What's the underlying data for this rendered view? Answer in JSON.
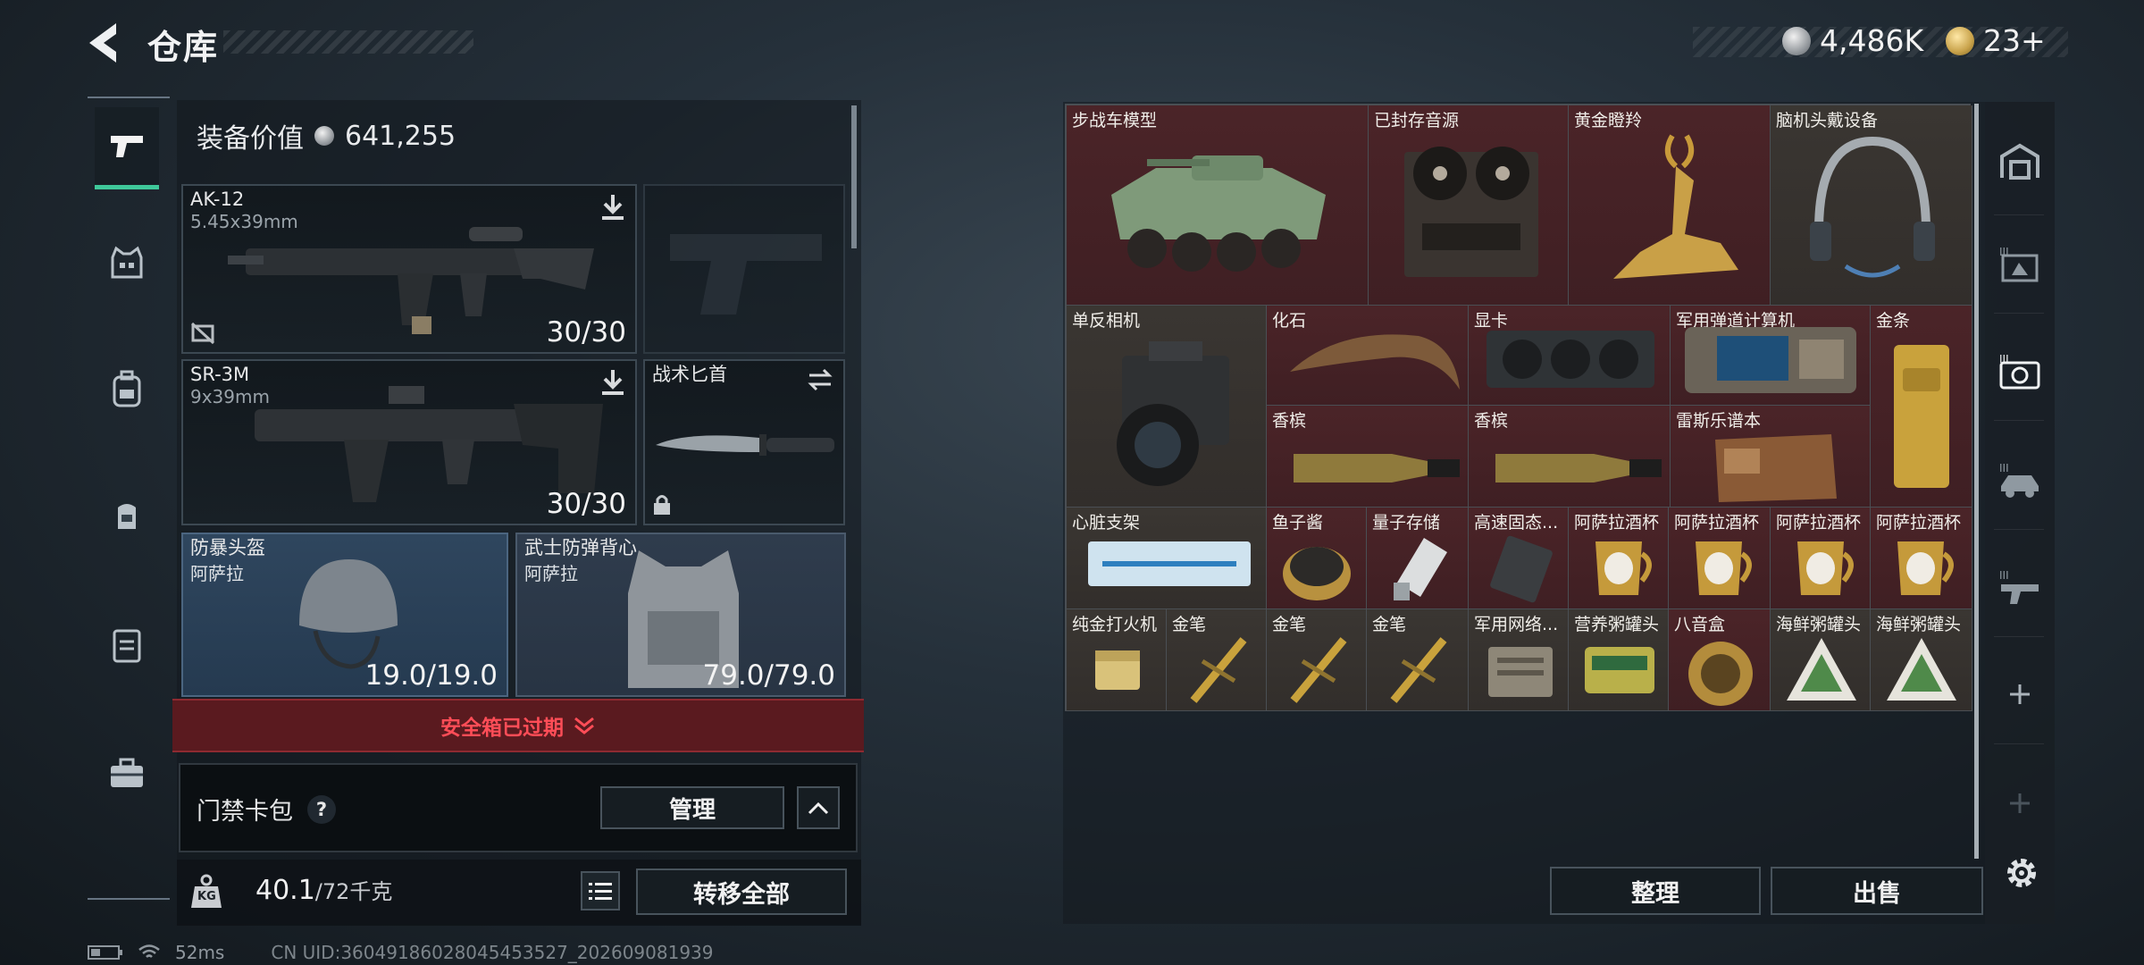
{
  "header": {
    "title": "仓库"
  },
  "currencies": {
    "silver": "4,486K",
    "gold": "23+"
  },
  "equipment": {
    "value_label": "装备价值",
    "value": "641,255",
    "slots": {
      "primary": {
        "name": "AK-12",
        "caliber": "5.45x39mm",
        "ammo": "30/30"
      },
      "secondary": {
        "name": "SR-3M",
        "caliber": "9x39mm",
        "ammo": "30/30"
      },
      "melee": {
        "name": "战术匕首"
      },
      "helmet": {
        "name": "防暴头盔",
        "brand": "阿萨拉",
        "durability": "19.0/19.0"
      },
      "vest": {
        "name": "武士防弹背心",
        "brand": "阿萨拉",
        "durability": "79.0/79.0"
      }
    },
    "safe_box_label": "安全箱已过期",
    "card_pack_label": "门禁卡包",
    "question_mark": "?",
    "manage_label": "管理",
    "weight_value": "40.1",
    "weight_limit": "/72千克",
    "weight_icon_text": "KG",
    "transfer_all_label": "转移全部"
  },
  "status": {
    "ping": "52ms",
    "uid": "CN UID:3604918602804545352​7_202609081939"
  },
  "stash": {
    "items": [
      {
        "label": "步战车模型"
      },
      {
        "label": "已封存音源"
      },
      {
        "label": "黄金瞪羚"
      },
      {
        "label": "脑机头戴设备"
      },
      {
        "label": "单反相机"
      },
      {
        "label": "化石"
      },
      {
        "label": "显卡"
      },
      {
        "label": "军用弹道计算机"
      },
      {
        "label": "金条"
      },
      {
        "label": "香槟"
      },
      {
        "label": "香槟"
      },
      {
        "label": "雷斯乐谱本"
      },
      {
        "label": "心脏支架"
      },
      {
        "label": "鱼子酱"
      },
      {
        "label": "量子存储"
      },
      {
        "label": "高速固态..."
      },
      {
        "label": "阿萨拉酒杯"
      },
      {
        "label": "阿萨拉酒杯"
      },
      {
        "label": "阿萨拉酒杯"
      },
      {
        "label": "阿萨拉酒杯"
      },
      {
        "label": "纯金打火机"
      },
      {
        "label": "金笔"
      },
      {
        "label": "金笔"
      },
      {
        "label": "金笔"
      },
      {
        "label": "军用网络..."
      },
      {
        "label": "营养粥罐头"
      },
      {
        "label": "八音盒"
      },
      {
        "label": "海鲜粥罐头"
      },
      {
        "label": "海鲜粥罐头"
      }
    ],
    "sort_label": "整理",
    "sell_label": "出售"
  },
  "colors": {
    "accent_green": "#3fc89a",
    "alert_red": "#ff4d57",
    "cell_red": "#4b2428",
    "cell_dark": "#3a3632"
  }
}
